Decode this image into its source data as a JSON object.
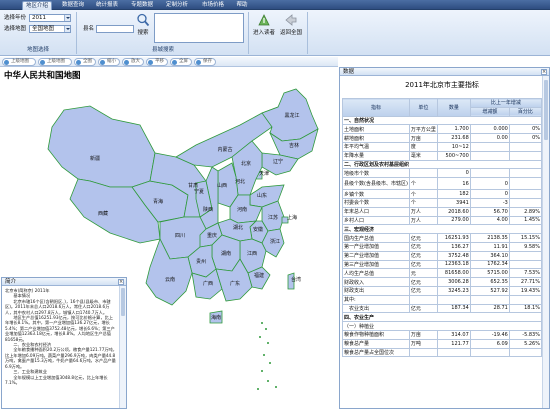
{
  "tabs": [
    {
      "label": "地区介绍",
      "active": true
    },
    {
      "label": "数据查询",
      "active": false
    },
    {
      "label": "统计报表",
      "active": false
    },
    {
      "label": "专题数据",
      "active": false
    },
    {
      "label": "定制分析",
      "active": false
    },
    {
      "label": "市场价格",
      "active": false
    },
    {
      "label": "帮助",
      "active": false
    }
  ],
  "ribbon": {
    "year_label": "选择年份",
    "year_value": "2011",
    "map_label": "选择地图",
    "map_value": "全国地图",
    "group_map": "地图选择",
    "county_label": "县名",
    "search_button": "搜索",
    "group_search": "县城搜索",
    "enter_button": "进入读者",
    "back_button": "返回全国"
  },
  "map_toolbar": {
    "tools": [
      "上级地图",
      "上级地图",
      "全图",
      "缩小",
      "放大",
      "平移",
      "全屏",
      "保存"
    ]
  },
  "map": {
    "title": "中华人民共和国地图",
    "provinces": [
      "新疆",
      "西藏",
      "青海",
      "甘肃",
      "内蒙古",
      "黑龙江",
      "吉林",
      "辽宁",
      "北京",
      "天津",
      "河北",
      "山西",
      "陕西",
      "宁夏",
      "山东",
      "河南",
      "江苏",
      "安徽",
      "湖北",
      "四川",
      "重庆",
      "浙江",
      "江西",
      "湖南",
      "贵州",
      "云南",
      "福建",
      "广西",
      "广东",
      "海南",
      "上海",
      "台湾"
    ],
    "fill_color": "#b3c3ec",
    "border_color": "#2f9a3b"
  },
  "intro": {
    "header": "简介",
    "text": "北京市(简称京)  2011年\n　　基本情况\n　　北京市辖16个区(含朝阳区、)，16个县(县级市、市辖区)。2011年末总人口2018.6万人，常住人口2018.6万人，其中农村人口297.8万人，城镇人口1740.7万人。\n　　地区生产总值16251.93亿元，按可比价格计算，比上年增长8.1%。其中，第一产业增加值136.27亿元，增长5.4%；第二产业增加值3752.48亿元，增长6.6%；第三产业增加值12363.18亿元，增长8.8%。人均地区生产总值81658元。\n　　二、农业和农村经济\n　　全年粮食播种面积20.2万公顷，粮食产量121.77万吨，比上年增加6.09万吨。蔬菜产量296.9万吨，肉类产量44.8万吨，禽蛋产量15.3万吨，牛奶产量64.6万吨，水产品产量6.9万吨。\n　　三、工业和建筑业\n　　全年规模以上工业增加值3048.8亿元，比上年增长7.1%。"
  },
  "data_panel": {
    "header": "数据",
    "title": "2011年北京市主要指标",
    "columns": {
      "indicator": "指标",
      "unit": "单位",
      "value": "数量",
      "compare": "比上一年增减",
      "amount": "增减额",
      "percent": "百分比"
    },
    "rows": [
      {
        "type": "sec",
        "name": "一、自然状况"
      },
      {
        "type": "row",
        "name": "土地面积",
        "unit": "万平方公里",
        "value": "1.700",
        "amount": "0.000",
        "percent": "0%"
      },
      {
        "type": "row",
        "name": "耕地面积",
        "unit": "万亩",
        "value": "231.68",
        "amount": "0.00",
        "percent": "0%"
      },
      {
        "type": "row",
        "name": "年平均气温",
        "unit": "度",
        "value": "10~12",
        "amount": "",
        "percent": ""
      },
      {
        "type": "row",
        "name": "年降水量",
        "unit": "毫米",
        "value": "500~700",
        "amount": "",
        "percent": ""
      },
      {
        "type": "sec",
        "name": "二、行政区划及农村基层组织"
      },
      {
        "type": "row",
        "name": "地级市个数",
        "unit": "",
        "value": "0",
        "amount": "",
        "percent": ""
      },
      {
        "type": "row2",
        "name": "县级个数(含县级市、市辖区)",
        "unit": "个",
        "value": "16",
        "amount": "0",
        "percent": ""
      },
      {
        "type": "row",
        "name": "乡镇个数",
        "unit": "个",
        "value": "182",
        "amount": "0",
        "percent": ""
      },
      {
        "type": "row",
        "name": "村委会个数",
        "unit": "个",
        "value": "3941",
        "amount": "-3",
        "percent": ""
      },
      {
        "type": "row",
        "name": "年末总人口",
        "unit": "万人",
        "value": "2018.60",
        "amount": "56.70",
        "percent": "2.89%"
      },
      {
        "type": "row",
        "name": "乡村人口",
        "unit": "万人",
        "value": "279.00",
        "amount": "4.00",
        "percent": "1.45%"
      },
      {
        "type": "sec",
        "name": "三、宏观经济"
      },
      {
        "type": "row",
        "name": "国内生产总值",
        "unit": "亿元",
        "value": "16251.93",
        "amount": "2138.35",
        "percent": "15.15%"
      },
      {
        "type": "row",
        "name": "第一产业增加值",
        "unit": "亿元",
        "value": "136.27",
        "amount": "11.91",
        "percent": "9.58%"
      },
      {
        "type": "row",
        "name": "第二产业增加值",
        "unit": "亿元",
        "value": "3752.48",
        "amount": "364.10",
        "percent": ""
      },
      {
        "type": "row",
        "name": "第三产业增加值",
        "unit": "亿元",
        "value": "12363.18",
        "amount": "1762.34",
        "percent": ""
      },
      {
        "type": "row",
        "name": "人均生产总值",
        "unit": "元",
        "value": "81658.00",
        "amount": "5715.00",
        "percent": "7.53%"
      },
      {
        "type": "row",
        "name": "财政收入",
        "unit": "亿元",
        "value": "3006.28",
        "amount": "652.35",
        "percent": "27.71%"
      },
      {
        "type": "row",
        "name": "财政支出",
        "unit": "亿元",
        "value": "3245.23",
        "amount": "527.92",
        "percent": "19.43%"
      },
      {
        "type": "row",
        "name": "其中:",
        "unit": "",
        "value": "",
        "amount": "",
        "percent": ""
      },
      {
        "type": "row",
        "name": "　农业支出",
        "unit": "亿元",
        "value": "187.34",
        "amount": "28.71",
        "percent": "18.1%"
      },
      {
        "type": "sec",
        "name": "四、农业生产"
      },
      {
        "type": "sub",
        "name": "（一）种植业"
      },
      {
        "type": "row",
        "name": "粮食作物种植面积",
        "unit": "万亩",
        "value": "314.07",
        "amount": "-19.46",
        "percent": "-5.83%"
      },
      {
        "type": "row",
        "name": "粮食总产量",
        "unit": "万吨",
        "value": "121.77",
        "amount": "6.09",
        "percent": "5.26%"
      },
      {
        "type": "row",
        "name": "粮食总产量占全国位次",
        "unit": "",
        "value": "",
        "amount": "",
        "percent": ""
      }
    ]
  }
}
